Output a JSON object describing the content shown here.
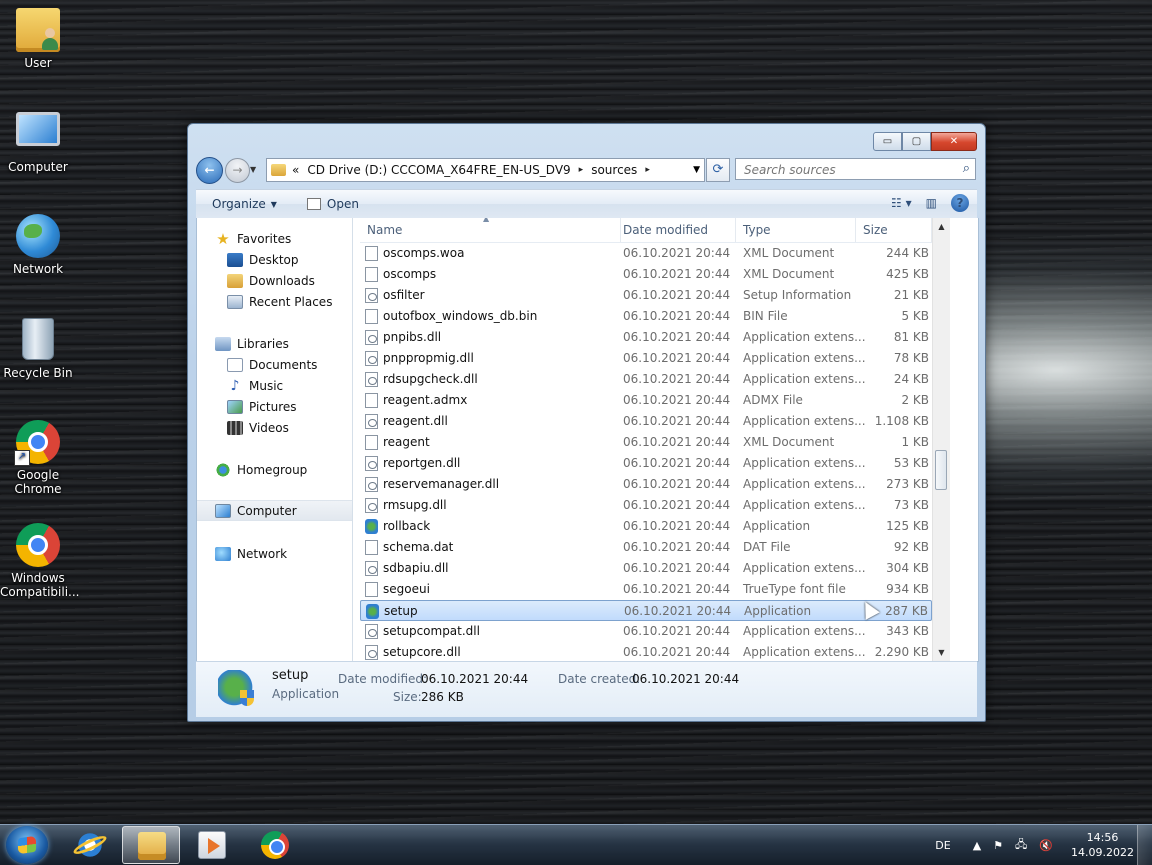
{
  "desktop": {
    "icons": [
      {
        "label": "User",
        "icon": "user-folder-icon"
      },
      {
        "label": "Computer",
        "icon": "computer-icon"
      },
      {
        "label": "Network",
        "icon": "network-icon"
      },
      {
        "label": "Recycle Bin",
        "icon": "recycle-bin-icon"
      },
      {
        "label": "Google Chrome",
        "icon": "chrome-icon"
      },
      {
        "label": "Windows Compatibili...",
        "icon": "chrome-icon"
      }
    ]
  },
  "window": {
    "controls": {
      "minimize": "▭",
      "maximize": "▢",
      "close": "✕"
    },
    "address": {
      "prefix": "«",
      "segments": [
        "CD Drive (D:) CCCOMA_X64FRE_EN-US_DV9",
        "sources"
      ],
      "separator": "▸"
    },
    "search_placeholder": "Search sources",
    "toolbar": {
      "organize": "Organize",
      "open": "Open"
    },
    "nav_pane": {
      "favorites": {
        "label": "Favorites",
        "items": [
          "Desktop",
          "Downloads",
          "Recent Places"
        ]
      },
      "libraries": {
        "label": "Libraries",
        "items": [
          "Documents",
          "Music",
          "Pictures",
          "Videos"
        ]
      },
      "homegroup": "Homegroup",
      "computer": "Computer",
      "network": "Network"
    },
    "columns": {
      "name": "Name",
      "date": "Date modified",
      "type": "Type",
      "size": "Size"
    },
    "files": [
      {
        "name": "oscomps.woa",
        "date": "06.10.2021 20:44",
        "type": "XML Document",
        "size": "244 KB",
        "icon": "doc"
      },
      {
        "name": "oscomps",
        "date": "06.10.2021 20:44",
        "type": "XML Document",
        "size": "425 KB",
        "icon": "doc"
      },
      {
        "name": "osfilter",
        "date": "06.10.2021 20:44",
        "type": "Setup Information",
        "size": "21 KB",
        "icon": "dll"
      },
      {
        "name": "outofbox_windows_db.bin",
        "date": "06.10.2021 20:44",
        "type": "BIN File",
        "size": "5 KB",
        "icon": "doc"
      },
      {
        "name": "pnpibs.dll",
        "date": "06.10.2021 20:44",
        "type": "Application extens...",
        "size": "81 KB",
        "icon": "dll"
      },
      {
        "name": "pnppropmig.dll",
        "date": "06.10.2021 20:44",
        "type": "Application extens...",
        "size": "78 KB",
        "icon": "dll"
      },
      {
        "name": "rdsupgcheck.dll",
        "date": "06.10.2021 20:44",
        "type": "Application extens...",
        "size": "24 KB",
        "icon": "dll"
      },
      {
        "name": "reagent.admx",
        "date": "06.10.2021 20:44",
        "type": "ADMX File",
        "size": "2 KB",
        "icon": "doc"
      },
      {
        "name": "reagent.dll",
        "date": "06.10.2021 20:44",
        "type": "Application extens...",
        "size": "1.108 KB",
        "icon": "dll"
      },
      {
        "name": "reagent",
        "date": "06.10.2021 20:44",
        "type": "XML Document",
        "size": "1 KB",
        "icon": "doc"
      },
      {
        "name": "reportgen.dll",
        "date": "06.10.2021 20:44",
        "type": "Application extens...",
        "size": "53 KB",
        "icon": "dll"
      },
      {
        "name": "reservemanager.dll",
        "date": "06.10.2021 20:44",
        "type": "Application extens...",
        "size": "273 KB",
        "icon": "dll"
      },
      {
        "name": "rmsupg.dll",
        "date": "06.10.2021 20:44",
        "type": "Application extens...",
        "size": "73 KB",
        "icon": "dll"
      },
      {
        "name": "rollback",
        "date": "06.10.2021 20:44",
        "type": "Application",
        "size": "125 KB",
        "icon": "app"
      },
      {
        "name": "schema.dat",
        "date": "06.10.2021 20:44",
        "type": "DAT File",
        "size": "92 KB",
        "icon": "doc"
      },
      {
        "name": "sdbapiu.dll",
        "date": "06.10.2021 20:44",
        "type": "Application extens...",
        "size": "304 KB",
        "icon": "dll"
      },
      {
        "name": "segoeui",
        "date": "06.10.2021 20:44",
        "type": "TrueType font file",
        "size": "934 KB",
        "icon": "doc"
      },
      {
        "name": "setup",
        "date": "06.10.2021 20:44",
        "type": "Application",
        "size": "287 KB",
        "icon": "app",
        "selected": true
      },
      {
        "name": "setupcompat.dll",
        "date": "06.10.2021 20:44",
        "type": "Application extens...",
        "size": "343 KB",
        "icon": "dll"
      },
      {
        "name": "setupcore.dll",
        "date": "06.10.2021 20:44",
        "type": "Application extens...",
        "size": "2.290 KB",
        "icon": "dll"
      }
    ],
    "details": {
      "name": "setup",
      "type": "Application",
      "date_modified_label": "Date modified:",
      "date_modified": "06.10.2021 20:44",
      "size_label": "Size:",
      "size": "286 KB",
      "date_created_label": "Date created:",
      "date_created": "06.10.2021 20:44"
    }
  },
  "taskbar": {
    "language": "DE",
    "time": "14:56",
    "date": "14.09.2022"
  }
}
